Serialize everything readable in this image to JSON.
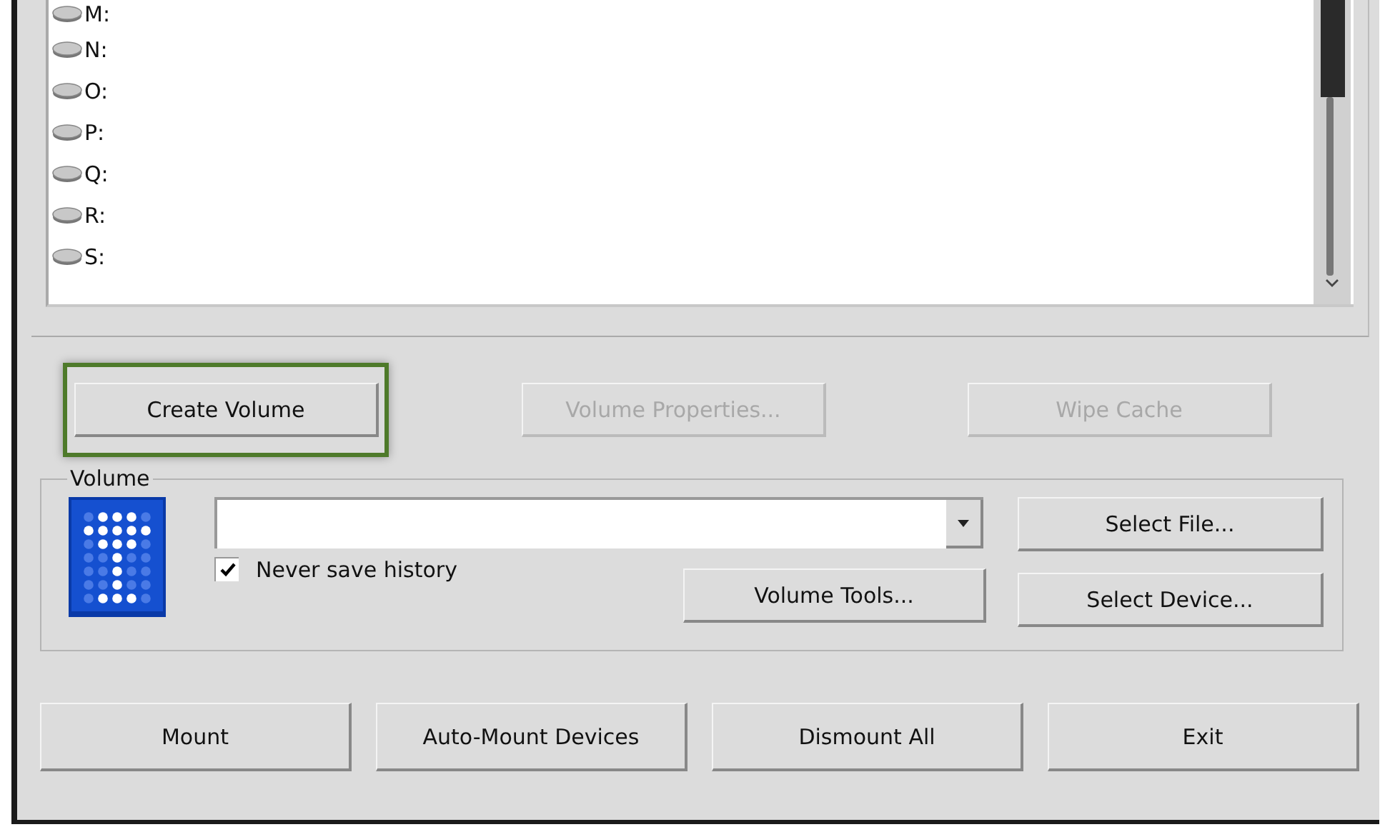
{
  "drives": [
    {
      "letter": "M:"
    },
    {
      "letter": "N:"
    },
    {
      "letter": "O:"
    },
    {
      "letter": "P:"
    },
    {
      "letter": "Q:"
    },
    {
      "letter": "R:"
    },
    {
      "letter": "S:"
    }
  ],
  "actions": [
    {
      "label": "Create Volume",
      "disabled": false,
      "highlighted": true
    },
    {
      "label": "Volume Properties...",
      "disabled": true,
      "highlighted": false
    },
    {
      "label": "Wipe Cache",
      "disabled": true,
      "highlighted": false
    }
  ],
  "volume": {
    "legend": "Volume",
    "never_save_history": {
      "label": "Never save history",
      "checked": true
    },
    "select_file": "Select File...",
    "volume_tools": "Volume Tools...",
    "select_device": "Select Device..."
  },
  "bottom_buttons": [
    "Mount",
    "Auto-Mount Devices",
    "Dismount All",
    "Exit"
  ]
}
